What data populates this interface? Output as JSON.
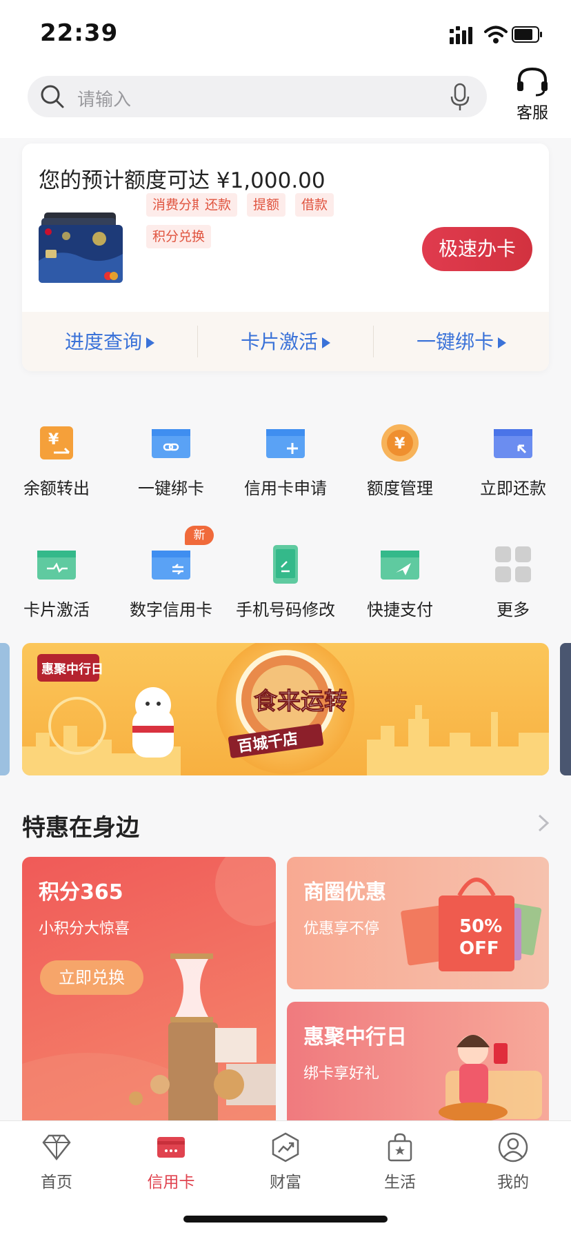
{
  "status_bar": {
    "time": "22:39"
  },
  "search": {
    "placeholder": "请输入"
  },
  "customer_service": {
    "label": "客服"
  },
  "credit_card": {
    "title": "您的预计额度可达 ¥1,000.00",
    "tags": [
      "消费分期",
      "还款",
      "提额",
      "借款",
      "积分兑换"
    ],
    "apply_button": "极速办卡",
    "quick_links": [
      "进度查询",
      "卡片激活",
      "一键绑卡"
    ]
  },
  "services": [
    {
      "label": "余额转出",
      "icon": "yen-transfer-icon",
      "color": "#f5a03a"
    },
    {
      "label": "一键绑卡",
      "icon": "card-link-icon",
      "color": "#3f8ef0"
    },
    {
      "label": "信用卡申请",
      "icon": "card-add-icon",
      "color": "#3f8ef0"
    },
    {
      "label": "额度管理",
      "icon": "yen-coin-icon",
      "color": "#f29a3c"
    },
    {
      "label": "立即还款",
      "icon": "card-repay-icon",
      "color": "#4a74e8"
    },
    {
      "label": "卡片激活",
      "icon": "card-activate-icon",
      "color": "#34b98a"
    },
    {
      "label": "数字信用卡",
      "icon": "digital-card-icon",
      "color": "#3f8ef0",
      "badge": "新"
    },
    {
      "label": "手机号码修改",
      "icon": "phone-edit-icon",
      "color": "#34b98a"
    },
    {
      "label": "快捷支付",
      "icon": "quick-pay-icon",
      "color": "#34b98a"
    },
    {
      "label": "更多",
      "icon": "more-grid-icon",
      "color": "#cfcfcf"
    }
  ],
  "banner": {
    "logo_text": "惠聚中行日",
    "headline": "食来运转",
    "sub": "百城千店"
  },
  "section": {
    "title": "特惠在身边"
  },
  "promos": [
    {
      "title": "积分365",
      "subtitle": "小积分大惊喜",
      "button": "立即兑换"
    },
    {
      "title": "商圈优惠",
      "subtitle": "优惠享不停",
      "sale": "50%",
      "sale2": "OFF"
    },
    {
      "title": "惠聚中行日",
      "subtitle": "绑卡享好礼"
    }
  ],
  "tabs": [
    {
      "label": "首页",
      "icon": "diamond-icon"
    },
    {
      "label": "信用卡",
      "icon": "credit-card-icon",
      "active": true
    },
    {
      "label": "财富",
      "icon": "wealth-chart-icon"
    },
    {
      "label": "生活",
      "icon": "shopping-bag-icon"
    },
    {
      "label": "我的",
      "icon": "user-icon"
    }
  ]
}
